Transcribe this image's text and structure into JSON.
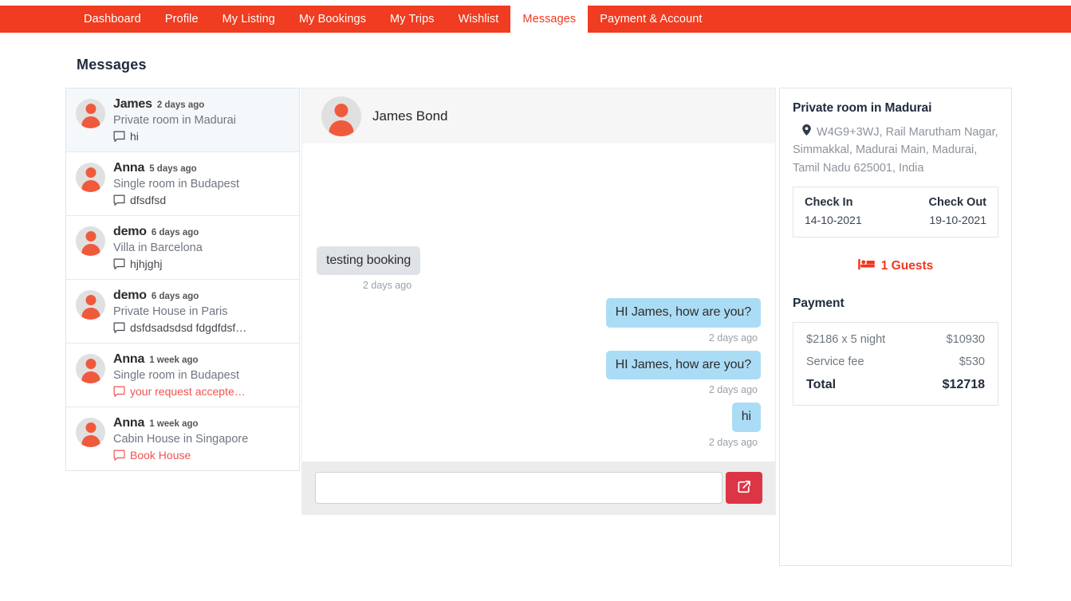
{
  "nav": {
    "items": [
      {
        "label": "Dashboard",
        "active": false
      },
      {
        "label": "Profile",
        "active": false
      },
      {
        "label": "My Listing",
        "active": false
      },
      {
        "label": "My Bookings",
        "active": false
      },
      {
        "label": "My Trips",
        "active": false
      },
      {
        "label": "Wishlist",
        "active": false
      },
      {
        "label": "Messages",
        "active": true
      },
      {
        "label": "Payment & Account",
        "active": false
      }
    ],
    "active_color": "#f03c21",
    "bar_color": "#f03c21"
  },
  "page": {
    "title": "Messages"
  },
  "conversations": [
    {
      "name": "James",
      "time": "2 days ago",
      "listing": "Private room in Madurai",
      "snippet": "hi",
      "unread": false,
      "selected": true
    },
    {
      "name": "Anna",
      "time": "5 days ago",
      "listing": "Single room in Budapest",
      "snippet": "dfsdfsd",
      "unread": false,
      "selected": false
    },
    {
      "name": "demo",
      "time": "6 days ago",
      "listing": "Villa in Barcelona",
      "snippet": "hjhjghj",
      "unread": false,
      "selected": false
    },
    {
      "name": "demo",
      "time": "6 days ago",
      "listing": "Private House in Paris",
      "snippet": "dsfdsadsdsd fdgdfdsf…",
      "unread": false,
      "selected": false
    },
    {
      "name": "Anna",
      "time": "1 week ago",
      "listing": "Single room in Budapest",
      "snippet": "your request accepte…",
      "unread": true,
      "selected": false
    },
    {
      "name": "Anna",
      "time": "1 week ago",
      "listing": "Cabin House in Singapore",
      "snippet": "Book House",
      "unread": true,
      "selected": false
    }
  ],
  "chat": {
    "header_name": "James Bond",
    "messages": [
      {
        "text": "testing booking",
        "time": "2 days ago",
        "direction": "in"
      },
      {
        "text": "HI James, how are you?",
        "time": "2 days ago",
        "direction": "out"
      },
      {
        "text": "HI James, how are you?",
        "time": "2 days ago",
        "direction": "out"
      },
      {
        "text": "hi",
        "time": "2 days ago",
        "direction": "out"
      }
    ],
    "input_value": "",
    "input_placeholder": "",
    "send_icon": "share-icon",
    "send_color": "#dc3545"
  },
  "booking": {
    "title": "Private room in Madurai",
    "address": "W4G9+3WJ, Rail Marutham Nagar, Simmakkal, Madurai Main, Madurai, Tamil Nadu 625001, India",
    "check_in_label": "Check In",
    "check_in_value": "14-10-2021",
    "check_out_label": "Check Out",
    "check_out_value": "19-10-2021",
    "guests_text": "1 Guests",
    "guests_color": "#f2361d",
    "payment_title": "Payment",
    "payment_rows": [
      {
        "label": "$2186 x 5 night",
        "value": "$10930",
        "total": false
      },
      {
        "label": "Service fee",
        "value": "$530",
        "total": false
      },
      {
        "label": "Total",
        "value": "$12718",
        "total": true
      }
    ]
  }
}
